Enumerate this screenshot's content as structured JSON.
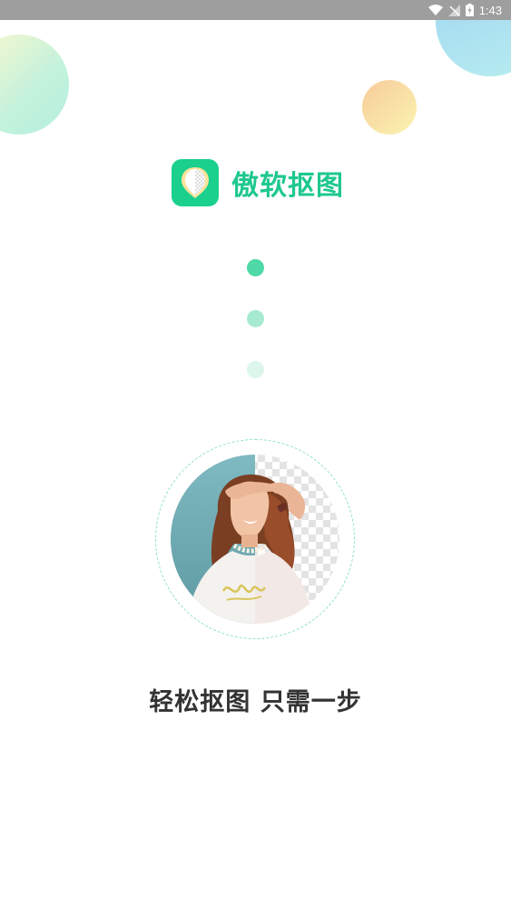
{
  "status_bar": {
    "time": "1:43",
    "icons": [
      "wifi-icon",
      "no-signal-icon",
      "battery-charging-icon"
    ]
  },
  "brand": {
    "app_name": "傲软抠图",
    "icon": "app-logo-icon",
    "accent_color": "#1ec88e"
  },
  "loading": {
    "dot_colors": [
      "#4ed9a6",
      "#a6ebd1",
      "#dcf6ec"
    ]
  },
  "showcase": {
    "image": "person-cutout-photo"
  },
  "slogan": "轻松抠图 只需一步"
}
